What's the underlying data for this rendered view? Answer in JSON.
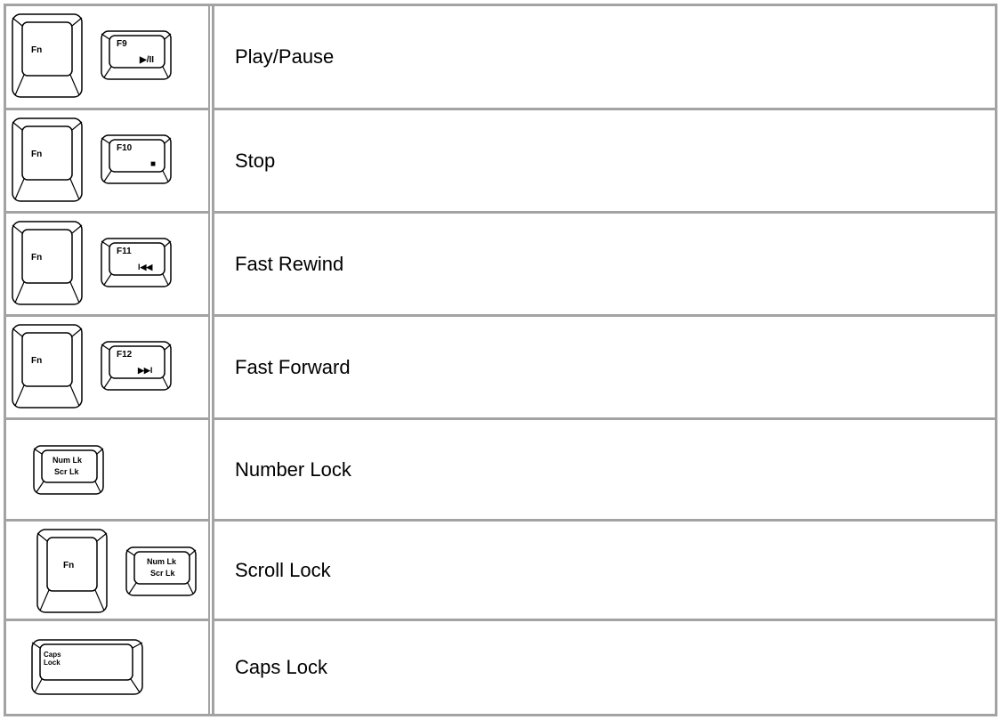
{
  "rows": [
    {
      "fn": "Fn",
      "keyTop": "F9",
      "keyGlyph": "▶/II",
      "label": "Play/Pause"
    },
    {
      "fn": "Fn",
      "keyTop": "F10",
      "keyGlyph": "■",
      "label": "Stop"
    },
    {
      "fn": "Fn",
      "keyTop": "F11",
      "keyGlyph": "I◀◀",
      "label": "Fast Rewind"
    },
    {
      "fn": "Fn",
      "keyTop": "F12",
      "keyGlyph": "▶▶I",
      "label": "Fast Forward"
    },
    {
      "keyLine1": "Num Lk",
      "keyLine2": "Scr Lk",
      "label": "Number Lock"
    },
    {
      "fn": "Fn",
      "keyLine1": "Num Lk",
      "keyLine2": "Scr Lk",
      "label": "Scroll Lock"
    },
    {
      "keyLine1": "Caps",
      "keyLine2": "Lock",
      "label": "Caps Lock"
    }
  ]
}
